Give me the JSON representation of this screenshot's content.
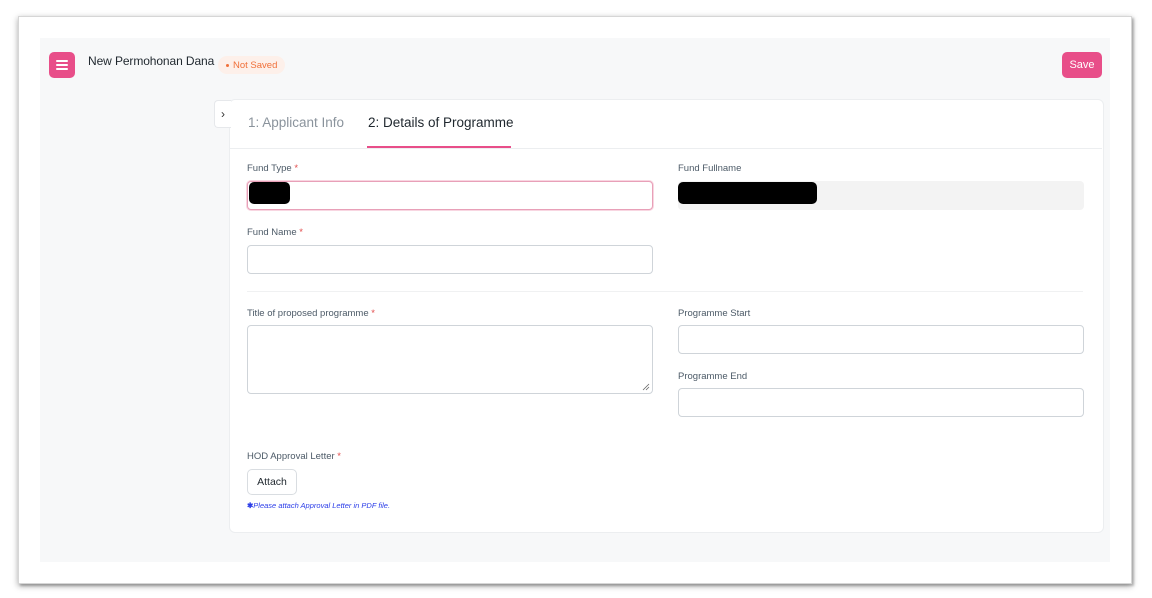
{
  "header": {
    "title": "New Permohonan Dana",
    "status": "Not Saved",
    "save_label": "Save"
  },
  "tabs": [
    {
      "label": "1: Applicant Info",
      "active": false
    },
    {
      "label": "2: Details of Programme",
      "active": true
    }
  ],
  "form": {
    "fund_type": {
      "label": "Fund Type",
      "required": "*"
    },
    "fund_fullname": {
      "label": "Fund Fullname"
    },
    "fund_name": {
      "label": "Fund Name",
      "required": "*",
      "value": ""
    },
    "title": {
      "label": "Title of proposed programme",
      "required": "*",
      "value": ""
    },
    "programme_start": {
      "label": "Programme Start",
      "value": ""
    },
    "programme_end": {
      "label": "Programme End",
      "value": ""
    },
    "hod_letter": {
      "label": "HOD Approval Letter",
      "required": "*",
      "attach_label": "Attach",
      "hint": "Please attach Approval Letter in PDF file."
    }
  },
  "icons": {
    "menu": "hamburger-icon",
    "collapse": "chevron-right-icon",
    "resize": "resize-handle-icon",
    "hint": "asterisk-icon"
  },
  "colors": {
    "accent": "#e84e89",
    "status": "#f0703a",
    "hint": "#2b3de8",
    "required": "#e24c4c"
  }
}
